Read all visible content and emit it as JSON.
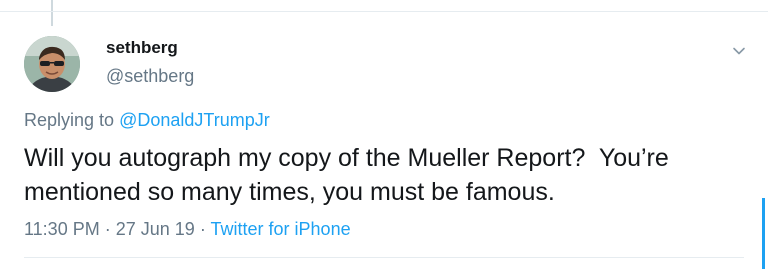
{
  "author": {
    "display_name": "sethberg",
    "handle": "@sethberg"
  },
  "reply": {
    "prefix": "Replying to",
    "mention": "@DonaldJTrumpJr"
  },
  "tweet": {
    "text": "Will you autograph my copy of the Mueller Report?  You’re mentioned so many times, you must be famous."
  },
  "meta": {
    "time": "11:30 PM",
    "separator": "·",
    "date": "27 Jun 19",
    "source": "Twitter for iPhone"
  },
  "icons": {
    "menu": "chevron-down-icon"
  },
  "colors": {
    "accent": "#1da1f2",
    "secondary_text": "#657786",
    "primary_text": "#14171a"
  }
}
